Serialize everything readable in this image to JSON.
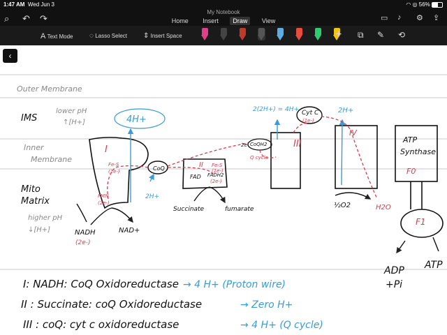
{
  "status": {
    "time": "1:47 AM",
    "date": "Wed Jun 3",
    "battery": "56%"
  },
  "app": {
    "notebook_title": "My Notebook"
  },
  "tabs": [
    {
      "label": "Home"
    },
    {
      "label": "Insert"
    },
    {
      "label": "Draw"
    },
    {
      "label": "View"
    }
  ],
  "active_tab": "Draw",
  "toolbar": {
    "text_mode": "Text Mode",
    "lasso_select": "Lasso Select",
    "insert_space": "Insert Space",
    "pen_colors": [
      "#e0408a",
      "#444444",
      "#c0392b",
      "#555555",
      "#5dade2",
      "#e74c3c",
      "#2ecc71",
      "#f1c40f"
    ]
  },
  "note": {
    "outer_membrane": "Outer Membrane",
    "ims": "IMS",
    "ims_note1": "lower pH",
    "ims_note2": "↑[H+]",
    "inner_membrane1": "Inner",
    "inner_membrane2": "Membrane",
    "mito1": "Mito",
    "mito2": "Matrix",
    "matrix_note1": "higher pH",
    "matrix_note2": "↓[H+]",
    "c1_label": "I",
    "c1_fes": "Fe-S",
    "c1_1e": "(1e-)",
    "c1_fmn": "FMN",
    "c1_2e": "(2e-)",
    "nadh": "NADH",
    "nadh_2e": "(2e-)",
    "nad": "NAD+",
    "four_h": "4H+",
    "coq": "CoQ",
    "two_h_a": "2H+",
    "c2_label": "II",
    "c2_fes": "Fe-S",
    "c2_1e": "(1e-)",
    "fad": "FAD",
    "fadh2": "FADH2",
    "fadh2_2e": "(2e-)",
    "succinate": "Succinate",
    "fumarate": "fumarate",
    "coqh2": "CoQH2",
    "q_cycle": "Q cycle",
    "two_e": "2e-",
    "c3_label": "III",
    "two_2h": "2(2H+) = 4H+",
    "cytc": "Cyt C",
    "cytc_1e": "(1e-)",
    "c4_label": "IV",
    "two_h_b": "2H+",
    "o2": "½O2",
    "h2o": "H2O",
    "atp_synthase1": "ATP",
    "atp_synthase2": "Synthase",
    "f0": "F0",
    "f1": "F1",
    "adp": "ADP",
    "pi": "+Pi",
    "atp": "ATP",
    "line1_a": "I: NADH: CoQ Oxidoreductase",
    "line1_b": "→ 4 H+ (Proton wire)",
    "line2_a": "II : Succinate: coQ Oxidoreductase",
    "line2_b": "→ Zero H+",
    "line3_a": "III : coQ: cyt c oxidoreductase",
    "line3_b": "→ 4 H+ (Q cycle)"
  }
}
